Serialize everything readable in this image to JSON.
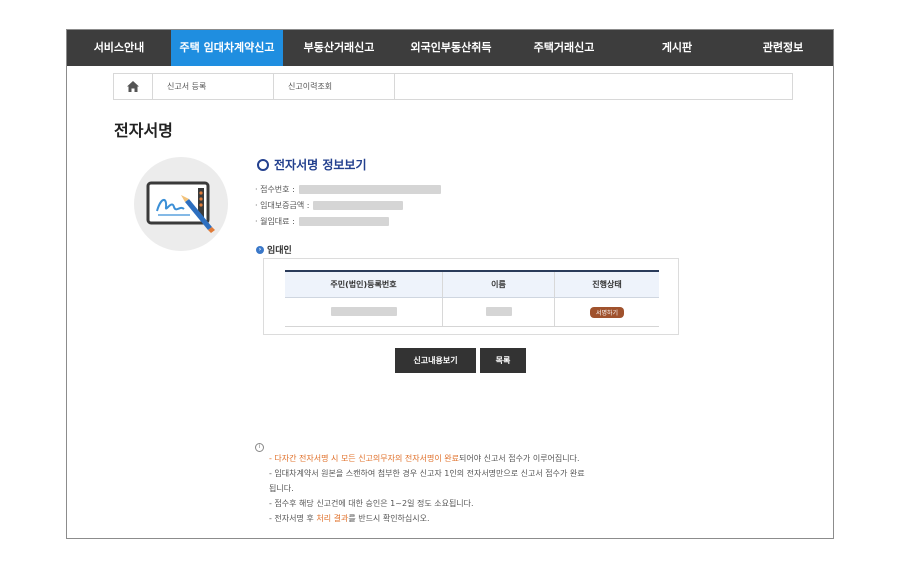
{
  "gnb": {
    "items": [
      {
        "label": "서비스안내",
        "active": false
      },
      {
        "label": "주택 임대차계약신고",
        "active": true
      },
      {
        "label": "부동산거래신고",
        "active": false
      },
      {
        "label": "외국인부동산취득",
        "active": false
      },
      {
        "label": "주택거래신고",
        "active": false
      },
      {
        "label": "게시판",
        "active": false
      },
      {
        "label": "관련정보",
        "active": false
      }
    ]
  },
  "subnav": {
    "icon": "home-icon",
    "tabs": [
      {
        "label": "신고서 등록"
      },
      {
        "label": "신고이력조회"
      }
    ]
  },
  "page": {
    "title": "전자서명"
  },
  "info": {
    "title": "전자서명 정보보기",
    "fields": [
      {
        "label": "· 접수번호 :"
      },
      {
        "label": "· 임대보증금액 :"
      },
      {
        "label": "· 월임대료 :"
      }
    ]
  },
  "lessor": {
    "label": "임대인",
    "headers": [
      "주민(법인)등록번호",
      "이름",
      "진행상태"
    ],
    "row": {
      "status": "서명하기"
    }
  },
  "buttons": {
    "view": "신고내용보기",
    "list": "목록"
  },
  "notes": {
    "icon": "info-icon",
    "line1_hl": "- 다자간 전자서명 시 모든 신고의무자의 전자서명이 완료",
    "line1_rest": "되어야 신고서 접수가 이루어집니다.",
    "line2a": "- 임대차계약서 원본을 스캔하여 첨부한 경우 신고자 1인의 전자서명만으로 신고서 접수가 완료",
    "line2b": "됩니다.",
    "line3": "- 접수후 해당 신고건에 대한 승인은 1~2일 정도 소요됩니다.",
    "line4_pre": "- 전자서명 후 ",
    "line4_hl": "처리 결과",
    "line4_post": "를 반드시 확인하십시오."
  },
  "colors": {
    "nav_bg": "#3d3d3d",
    "nav_active": "#1f8ee0",
    "title_blue": "#23408e",
    "highlight": "#e0702a",
    "badge": "#a0522d"
  }
}
